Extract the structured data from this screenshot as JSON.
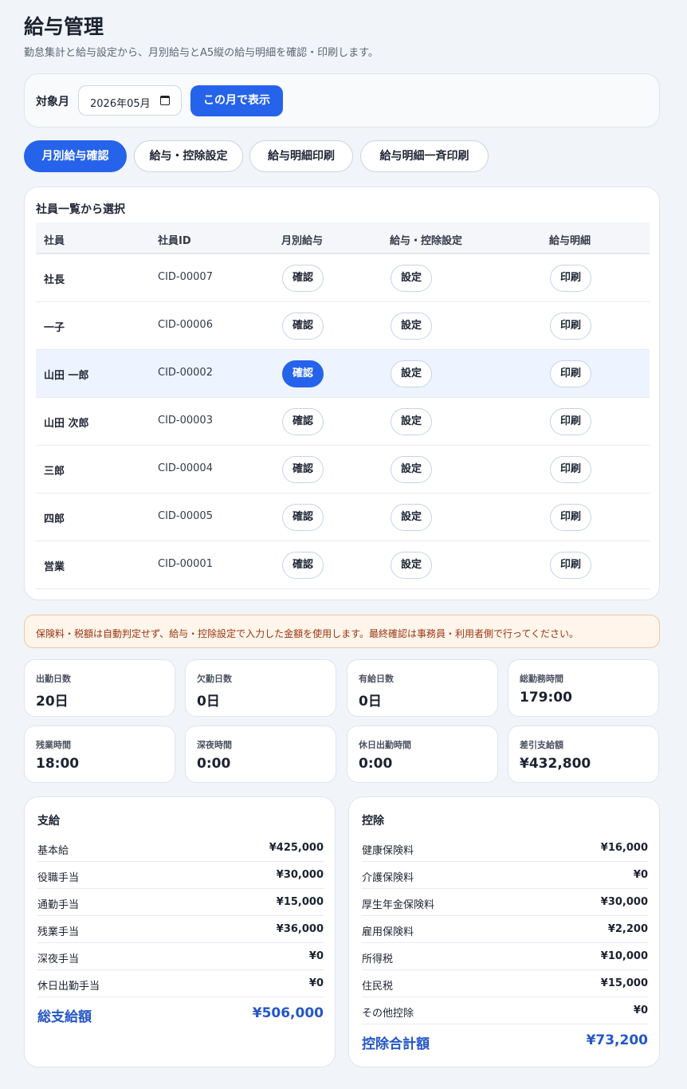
{
  "header": {
    "title": "給与管理",
    "subtitle": "勤怠集計と給与設定から、月別給与とA5縦の給与明細を確認・印刷します。"
  },
  "month_bar": {
    "label": "対象月",
    "value": "2026年05月",
    "show_button": "この月で表示"
  },
  "tabs": [
    {
      "label": "月別給与確認",
      "active": true
    },
    {
      "label": "給与・控除設定",
      "active": false
    },
    {
      "label": "給与明細印刷",
      "active": false
    },
    {
      "label": "給与明細一斉印刷",
      "active": false
    }
  ],
  "employee_list": {
    "title": "社員一覧から選択",
    "columns": [
      "社員",
      "社員ID",
      "月別給与",
      "給与・控除設定",
      "給与明細"
    ],
    "actions": {
      "confirm": "確認",
      "settings": "設定",
      "print": "印刷"
    },
    "rows": [
      {
        "name": "社長",
        "id": "CID-00007"
      },
      {
        "name": "一子",
        "id": "CID-00006"
      },
      {
        "name": "山田 一郎",
        "id": "CID-00002",
        "selected": true
      },
      {
        "name": "山田 次郎",
        "id": "CID-00003"
      },
      {
        "name": "三郎",
        "id": "CID-00004"
      },
      {
        "name": "四郎",
        "id": "CID-00005"
      },
      {
        "name": "営業",
        "id": "CID-00001"
      }
    ]
  },
  "notice": "保険料・税額は自動判定せず、給与・控除設定で入力した金額を使用します。最終確認は事務員・利用者側で行ってください。",
  "stats": [
    {
      "label": "出勤日数",
      "value": "20日"
    },
    {
      "label": "欠勤日数",
      "value": "0日"
    },
    {
      "label": "有給日数",
      "value": "0日"
    },
    {
      "label": "総勤務時間",
      "value": "179:00"
    },
    {
      "label": "残業時間",
      "value": "18:00"
    },
    {
      "label": "深夜時間",
      "value": "0:00"
    },
    {
      "label": "休日出勤時間",
      "value": "0:00"
    },
    {
      "label": "差引支給額",
      "value": "¥432,800"
    }
  ],
  "payments": {
    "title": "支給",
    "items": [
      {
        "label": "基本給",
        "value": "¥425,000"
      },
      {
        "label": "役職手当",
        "value": "¥30,000"
      },
      {
        "label": "通勤手当",
        "value": "¥15,000"
      },
      {
        "label": "残業手当",
        "value": "¥36,000"
      },
      {
        "label": "深夜手当",
        "value": "¥0"
      },
      {
        "label": "休日出勤手当",
        "value": "¥0"
      }
    ],
    "total_label": "総支給額",
    "total_value": "¥506,000"
  },
  "deductions": {
    "title": "控除",
    "items": [
      {
        "label": "健康保険料",
        "value": "¥16,000"
      },
      {
        "label": "介護保険料",
        "value": "¥0"
      },
      {
        "label": "厚生年金保険料",
        "value": "¥30,000"
      },
      {
        "label": "雇用保険料",
        "value": "¥2,200"
      },
      {
        "label": "所得税",
        "value": "¥10,000"
      },
      {
        "label": "住民税",
        "value": "¥15,000"
      },
      {
        "label": "その他控除",
        "value": "¥0"
      }
    ],
    "total_label": "控除合計額",
    "total_value": "¥73,200"
  },
  "colors": {
    "accent": "#2563eb",
    "total_text": "#2456c8",
    "selected_row": "#edf4ff",
    "notice_bg": "#fff5ea",
    "notice_text": "#9a3412"
  }
}
